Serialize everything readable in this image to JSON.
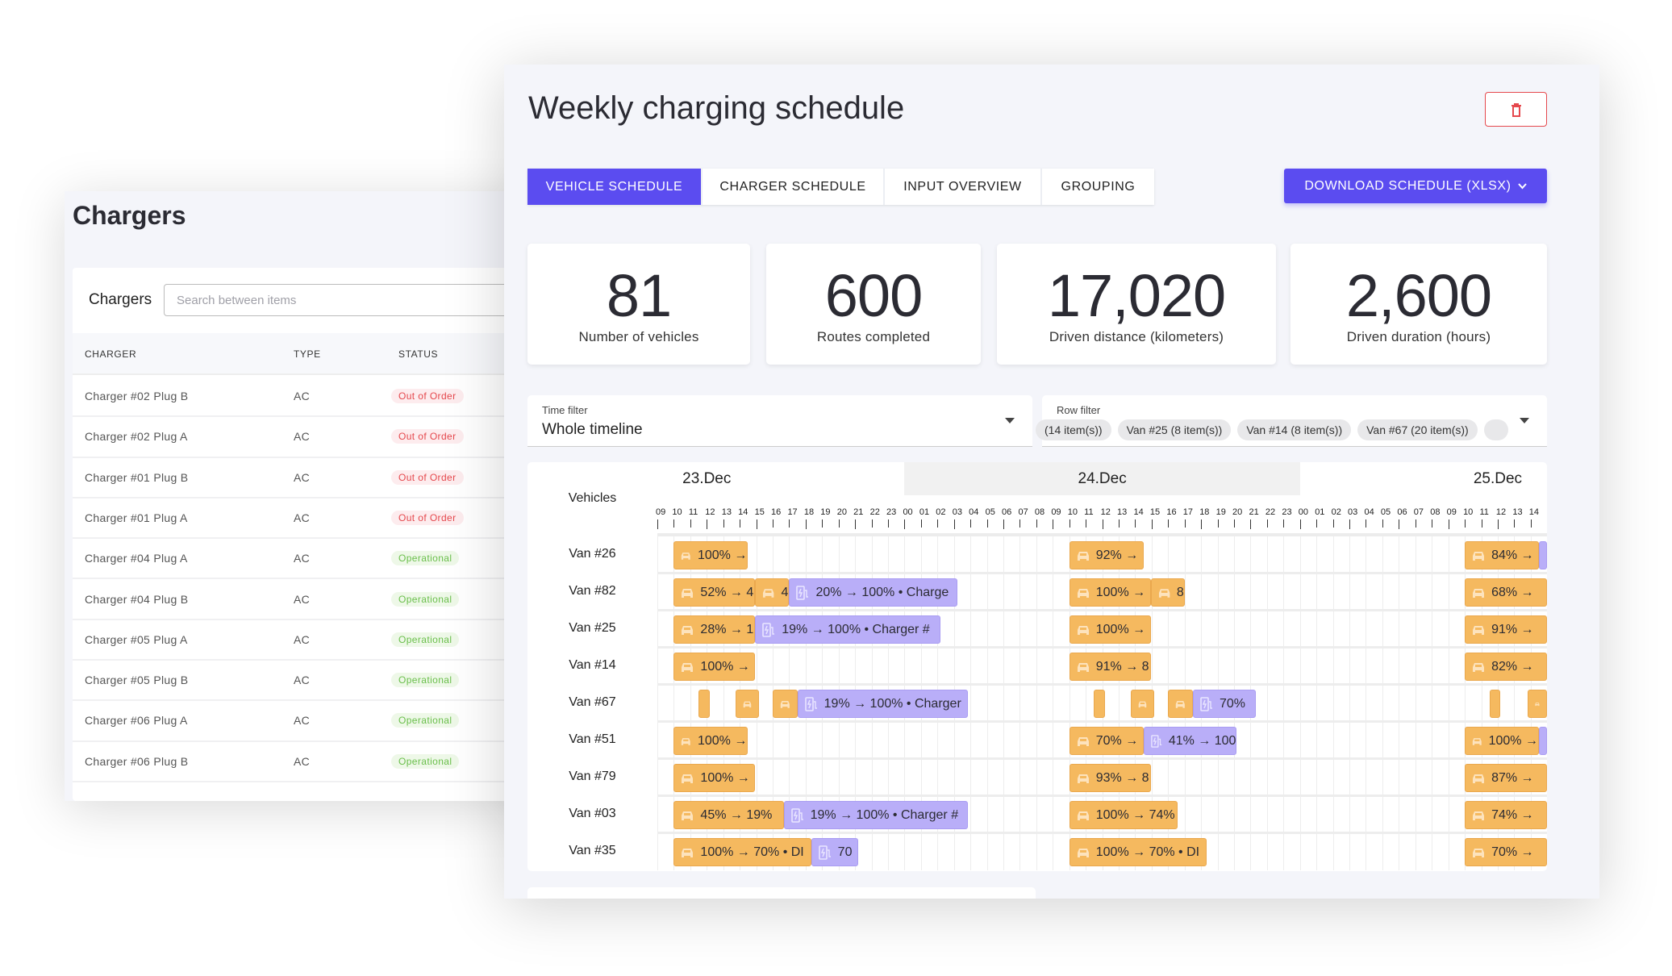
{
  "chargers_page": {
    "title": "Chargers",
    "card_label": "Chargers",
    "search_placeholder": "Search between items",
    "columns": [
      "CHARGER",
      "TYPE",
      "STATUS"
    ],
    "rows": [
      {
        "charger": "Charger #02 Plug B",
        "type": "AC",
        "status": "Out of Order"
      },
      {
        "charger": "Charger #02 Plug A",
        "type": "AC",
        "status": "Out of Order"
      },
      {
        "charger": "Charger #01 Plug B",
        "type": "AC",
        "status": "Out of Order"
      },
      {
        "charger": "Charger #01 Plug A",
        "type": "AC",
        "status": "Out of Order"
      },
      {
        "charger": "Charger #04 Plug A",
        "type": "AC",
        "status": "Operational"
      },
      {
        "charger": "Charger #04 Plug B",
        "type": "AC",
        "status": "Operational"
      },
      {
        "charger": "Charger #05 Plug A",
        "type": "AC",
        "status": "Operational"
      },
      {
        "charger": "Charger #05 Plug B",
        "type": "AC",
        "status": "Operational"
      },
      {
        "charger": "Charger #06 Plug A",
        "type": "AC",
        "status": "Operational"
      },
      {
        "charger": "Charger #06 Plug B",
        "type": "AC",
        "status": "Operational"
      }
    ],
    "status_colors": {
      "Out of Order": {
        "text": "#e5484d",
        "bg": "#fdecee"
      },
      "Operational": {
        "text": "#6abf4b",
        "bg": "#eef8e8"
      }
    }
  },
  "schedule": {
    "title": "Weekly charging schedule",
    "delete_icon": "trash-icon",
    "tabs": [
      {
        "label": "VEHICLE SCHEDULE",
        "active": true
      },
      {
        "label": "CHARGER SCHEDULE",
        "active": false
      },
      {
        "label": "INPUT OVERVIEW",
        "active": false
      },
      {
        "label": "GROUPING",
        "active": false
      }
    ],
    "download_label": "DOWNLOAD SCHEDULE (XLSX)",
    "stats": [
      {
        "value": "81",
        "label": "Number of vehicles"
      },
      {
        "value": "600",
        "label": "Routes completed"
      },
      {
        "value": "17,020",
        "label": "Driven distance (kilometers)"
      },
      {
        "value": "2,600",
        "label": "Driven duration (hours)"
      }
    ],
    "time_filter": {
      "label": "Time filter",
      "value": "Whole timeline"
    },
    "row_filter": {
      "label": "Row filter",
      "chips": [
        "(14 item(s))",
        "Van #25 (8 item(s))",
        "Van #14 (8 item(s))",
        "Van #67 (20 item(s))",
        ""
      ]
    },
    "accent": "#5b4cf0",
    "bar_colors": {
      "drive": "#f5b95f",
      "charge": "#b9aef8"
    }
  },
  "gantt": {
    "row_header": "Vehicles",
    "dates": [
      "23.Dec",
      "24.Dec",
      "25.Dec"
    ],
    "hour_labels": [
      "09",
      "10",
      "11",
      "12",
      "13",
      "14",
      "15",
      "16",
      "17",
      "18",
      "19",
      "20",
      "21",
      "22",
      "23",
      "00",
      "01",
      "02",
      "03",
      "04",
      "05",
      "06",
      "07",
      "08",
      "09",
      "10",
      "11",
      "12",
      "13",
      "14",
      "15",
      "16",
      "17",
      "18",
      "19",
      "20",
      "21",
      "22",
      "23",
      "00",
      "01",
      "02",
      "03",
      "04",
      "05",
      "06",
      "07",
      "08",
      "09",
      "10",
      "11",
      "12",
      "13",
      "14"
    ],
    "timeline_start": "23.Dec 09:00",
    "timeline_end": "25.Dec 15:00",
    "rows": [
      {
        "vehicle": "Van #26",
        "bars": [
          {
            "kind": "drive",
            "start": "23.Dec 10:00",
            "end": "23.Dec 14:30",
            "label": "100% →"
          },
          {
            "kind": "drive",
            "start": "24.Dec 10:00",
            "end": "24.Dec 14:30",
            "label": "92% →"
          },
          {
            "kind": "drive",
            "start": "25.Dec 10:00",
            "end": "25.Dec 14:30",
            "label": "84% →"
          },
          {
            "kind": "charge",
            "start": "25.Dec 14:30",
            "end": "25.Dec 15:00",
            "label": ""
          }
        ]
      },
      {
        "vehicle": "Van #82",
        "bars": [
          {
            "kind": "drive",
            "start": "23.Dec 10:00",
            "end": "23.Dec 14:56",
            "label": "52% → 4"
          },
          {
            "kind": "drive",
            "start": "23.Dec 14:56",
            "end": "23.Dec 17:00",
            "label": "4"
          },
          {
            "kind": "charge",
            "start": "23.Dec 17:00",
            "end": "24.Dec 03:12",
            "label": "20% → 100% • Charge"
          },
          {
            "kind": "drive",
            "start": "24.Dec 10:00",
            "end": "24.Dec 14:56",
            "label": "100% →"
          },
          {
            "kind": "drive",
            "start": "24.Dec 14:56",
            "end": "24.Dec 17:00",
            "label": "8"
          },
          {
            "kind": "drive",
            "start": "25.Dec 10:00",
            "end": "25.Dec 15:00",
            "label": "68% →"
          }
        ]
      },
      {
        "vehicle": "Van #25",
        "bars": [
          {
            "kind": "drive",
            "start": "23.Dec 10:00",
            "end": "23.Dec 14:56",
            "label": "28% → 1"
          },
          {
            "kind": "charge",
            "start": "23.Dec 14:56",
            "end": "24.Dec 02:10",
            "label": "19% → 100% • Charger #"
          },
          {
            "kind": "drive",
            "start": "24.Dec 10:00",
            "end": "24.Dec 14:56",
            "label": "100% →"
          },
          {
            "kind": "drive",
            "start": "25.Dec 10:00",
            "end": "25.Dec 15:00",
            "label": "91% →"
          }
        ]
      },
      {
        "vehicle": "Van #14",
        "bars": [
          {
            "kind": "drive",
            "start": "23.Dec 10:00",
            "end": "23.Dec 14:56",
            "label": "100% →"
          },
          {
            "kind": "drive",
            "start": "24.Dec 10:00",
            "end": "24.Dec 14:56",
            "label": "91% → 8"
          },
          {
            "kind": "drive",
            "start": "25.Dec 10:00",
            "end": "25.Dec 15:00",
            "label": "82% →"
          }
        ]
      },
      {
        "vehicle": "Van #67",
        "bars": [
          {
            "kind": "drive",
            "start": "23.Dec 11:30",
            "end": "23.Dec 12:10",
            "label": ""
          },
          {
            "kind": "drive",
            "start": "23.Dec 13:45",
            "end": "23.Dec 15:10",
            "label": ""
          },
          {
            "kind": "drive",
            "start": "23.Dec 16:00",
            "end": "23.Dec 17:30",
            "label": ""
          },
          {
            "kind": "charge",
            "start": "23.Dec 17:30",
            "end": "24.Dec 03:50",
            "label": "19% → 100% • Charger"
          },
          {
            "kind": "drive",
            "start": "24.Dec 11:30",
            "end": "24.Dec 12:10",
            "label": ""
          },
          {
            "kind": "drive",
            "start": "24.Dec 13:45",
            "end": "24.Dec 15:10",
            "label": ""
          },
          {
            "kind": "drive",
            "start": "24.Dec 16:00",
            "end": "24.Dec 17:30",
            "label": ""
          },
          {
            "kind": "charge",
            "start": "24.Dec 17:30",
            "end": "24.Dec 21:20",
            "label": "70%"
          },
          {
            "kind": "drive",
            "start": "25.Dec 11:30",
            "end": "25.Dec 12:10",
            "label": ""
          },
          {
            "kind": "drive",
            "start": "25.Dec 13:50",
            "end": "25.Dec 15:00",
            "label": ""
          }
        ]
      },
      {
        "vehicle": "Van #51",
        "bars": [
          {
            "kind": "drive",
            "start": "23.Dec 10:00",
            "end": "23.Dec 14:30",
            "label": "100% →"
          },
          {
            "kind": "drive",
            "start": "24.Dec 10:00",
            "end": "24.Dec 14:30",
            "label": "70% →"
          },
          {
            "kind": "charge",
            "start": "24.Dec 14:30",
            "end": "24.Dec 20:10",
            "label": "41% → 100"
          },
          {
            "kind": "drive",
            "start": "25.Dec 10:00",
            "end": "25.Dec 14:30",
            "label": "100% →"
          },
          {
            "kind": "charge",
            "start": "25.Dec 14:30",
            "end": "25.Dec 15:00",
            "label": ""
          }
        ]
      },
      {
        "vehicle": "Van #79",
        "bars": [
          {
            "kind": "drive",
            "start": "23.Dec 10:00",
            "end": "23.Dec 14:56",
            "label": "100% →"
          },
          {
            "kind": "drive",
            "start": "24.Dec 10:00",
            "end": "24.Dec 14:56",
            "label": "93% → 8"
          },
          {
            "kind": "drive",
            "start": "25.Dec 10:00",
            "end": "25.Dec 15:00",
            "label": "87% →"
          }
        ]
      },
      {
        "vehicle": "Van #03",
        "bars": [
          {
            "kind": "drive",
            "start": "23.Dec 10:00",
            "end": "23.Dec 16:40",
            "label": "45% → 19%"
          },
          {
            "kind": "charge",
            "start": "23.Dec 16:40",
            "end": "24.Dec 03:50",
            "label": "19% → 100% • Charger #"
          },
          {
            "kind": "drive",
            "start": "24.Dec 10:00",
            "end": "24.Dec 16:35",
            "label": "100% → 74%"
          },
          {
            "kind": "drive",
            "start": "25.Dec 10:00",
            "end": "25.Dec 15:00",
            "label": "74% →"
          }
        ]
      },
      {
        "vehicle": "Van #35",
        "bars": [
          {
            "kind": "drive",
            "start": "23.Dec 10:00",
            "end": "23.Dec 18:20",
            "label": "100% → 70% • DI"
          },
          {
            "kind": "charge",
            "start": "23.Dec 18:20",
            "end": "23.Dec 21:10",
            "label": "70"
          },
          {
            "kind": "drive",
            "start": "24.Dec 10:00",
            "end": "24.Dec 18:20",
            "label": "100% → 70% • DI"
          },
          {
            "kind": "drive",
            "start": "25.Dec 10:00",
            "end": "25.Dec 15:00",
            "label": "70% →"
          }
        ]
      }
    ]
  }
}
